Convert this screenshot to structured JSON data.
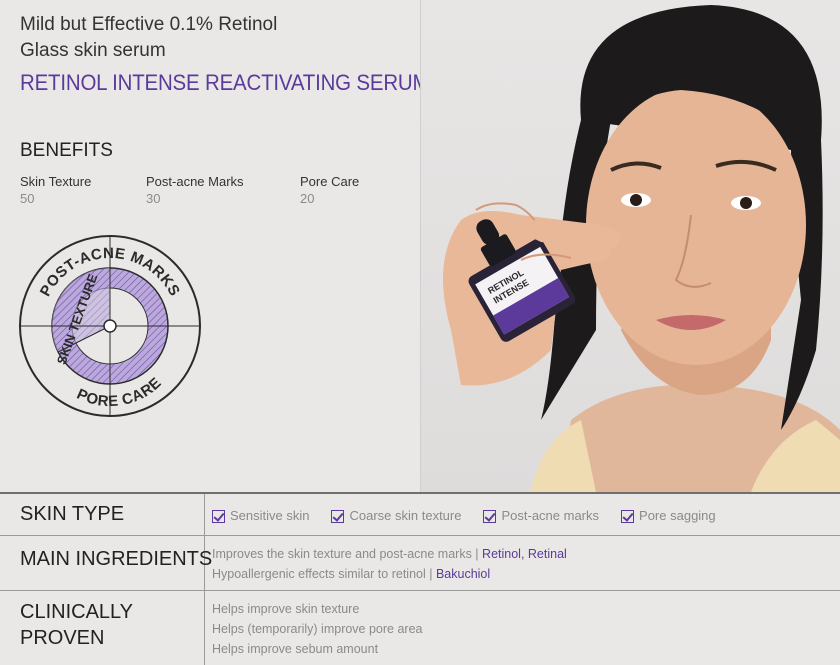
{
  "header": {
    "tagline_line1": "Mild but Effective 0.1% Retinol",
    "tagline_line2": "Glass skin serum",
    "product_name": "RETINOL INTENSE REACTIVATING SERUM"
  },
  "benefits": {
    "title": "BENEFITS",
    "items": [
      {
        "label": "Skin Texture",
        "value": "50"
      },
      {
        "label": "Post-acne Marks",
        "value": "30"
      },
      {
        "label": "Pore Care",
        "value": "20"
      }
    ],
    "wheel_labels": {
      "top": "POST-ACNE MARKS",
      "left": "SKIN TEXTURE",
      "bottom": "PORE CARE"
    }
  },
  "bottle": {
    "line1": "RETINOL",
    "line2": "INTENSE"
  },
  "skin_type": {
    "label": "SKIN TYPE",
    "options": [
      "Sensitive skin",
      "Coarse skin texture",
      "Post-acne marks",
      "Pore sagging"
    ]
  },
  "ingredients": {
    "label": "MAIN INGREDIENTS",
    "line1_text": "Improves the skin texture and post-acne marks | ",
    "line1_highlight": "Retinol, Retinal",
    "line2_text": "Hypoallergenic effects similar to retinol | ",
    "line2_highlight": "Bakuchiol"
  },
  "clinical": {
    "label_line1": "CLINICALLY",
    "label_line2": "PROVEN",
    "items": [
      "Helps improve skin texture",
      "Helps (temporarily) improve pore area",
      "Helps improve sebum amount"
    ]
  },
  "colors": {
    "accent": "#5b3a9c",
    "wheel_fill": "#b7a4d9"
  }
}
